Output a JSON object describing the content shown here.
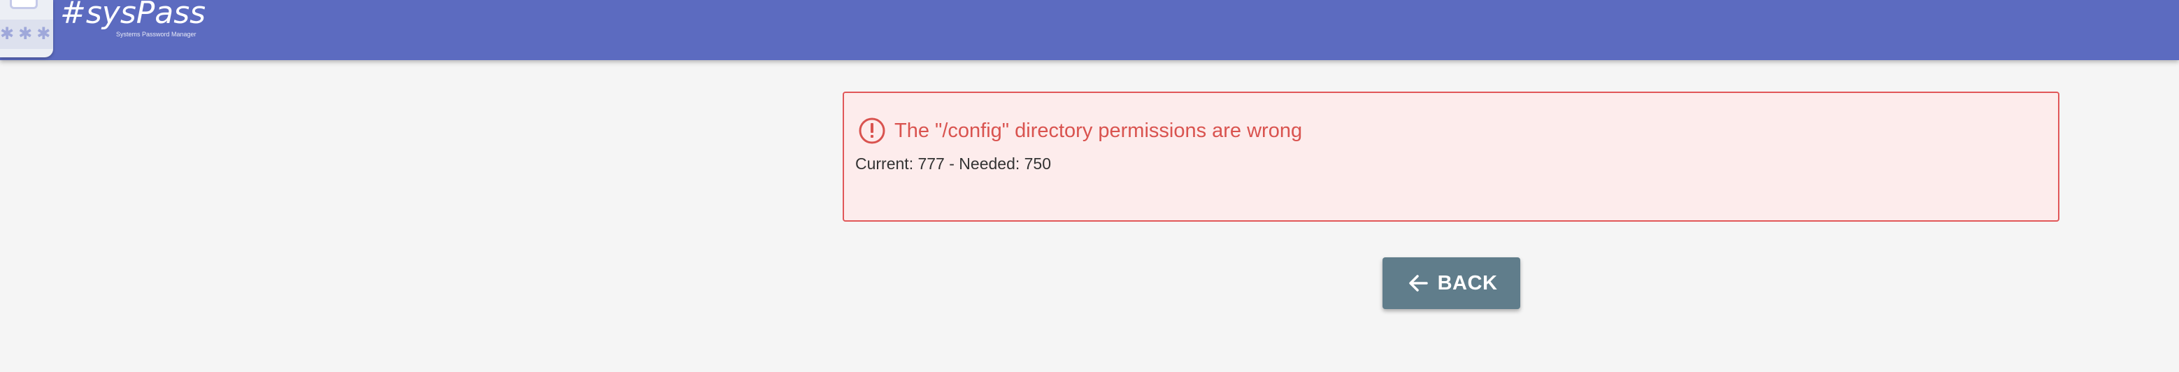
{
  "header": {
    "brand_name": "#sysPass",
    "tagline": "Systems Password Manager",
    "logo_icon": "lock-icon",
    "accent_color": "#5c6bc0"
  },
  "error": {
    "icon": "error-icon",
    "title": "The \"/config\" directory permissions are wrong",
    "detail": "Current: 777 - Needed: 750",
    "color": "#d9534f"
  },
  "actions": {
    "back_label": "BACK",
    "back_icon": "arrow-left-icon"
  }
}
